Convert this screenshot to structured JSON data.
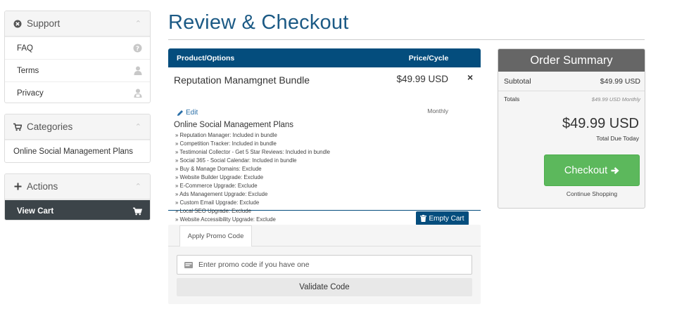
{
  "sidebar": {
    "support": {
      "title": "Support",
      "items": [
        {
          "label": "FAQ"
        },
        {
          "label": "Terms"
        },
        {
          "label": "Privacy"
        }
      ]
    },
    "categories": {
      "title": "Categories",
      "items": [
        {
          "label": "Online Social Management Plans"
        }
      ]
    },
    "actions": {
      "title": "Actions",
      "items": [
        {
          "label": "View Cart"
        }
      ]
    }
  },
  "page": {
    "title": "Review & Checkout"
  },
  "cart": {
    "headers": {
      "product": "Product/Options",
      "price": "Price/Cycle"
    },
    "item": {
      "name": "Reputation Manamgnet Bundle",
      "edit_label": "Edit",
      "price": "$49.99 USD",
      "cycle": "Monthly",
      "remove_symbol": "×",
      "group": "Online Social Management Plans",
      "options": [
        "» Reputation Manager: Included in bundle",
        "» Competition Tracker: Included in bundle",
        "» Testimonial Collector - Get 5 Star Reviews: Included in bundle",
        "» Social 365 - Social Calendar: Included in bundle",
        "» Buy & Manage Domains: Exclude",
        "» Website Builder Upgrade: Exclude",
        "» E-Commerce Upgrade: Exclude",
        "» Ads Management Upgrade: Exclude",
        "» Custom Email Upgrade: Exclude",
        "» Local SEO Upgrade: Exclude",
        "» Website Accessibility Upgrade: Exclude"
      ]
    },
    "empty_cart_label": "Empty Cart"
  },
  "promo": {
    "tab_label": "Apply Promo Code",
    "placeholder": "Enter promo code if you have one",
    "validate_label": "Validate Code"
  },
  "summary": {
    "title": "Order Summary",
    "subtotal_label": "Subtotal",
    "subtotal_value": "$49.99 USD",
    "totals_label": "Totals",
    "totals_value": "$49.99 USD Monthly",
    "total_amount": "$49.99 USD",
    "total_due_label": "Total Due Today",
    "checkout_label": "Checkout",
    "continue_label": "Continue Shopping"
  },
  "colors": {
    "brand_blue": "#044d7d",
    "title_blue": "#1c5a85",
    "checkout_green": "#5cb85c",
    "sidebar_active": "#3c4449",
    "summary_header": "#666666"
  },
  "icons": {
    "support": "circle-x-icon",
    "faq": "question-circle-icon",
    "terms": "user-icon",
    "privacy": "lock-user-icon",
    "categories": "cart-icon",
    "actions": "plus-icon",
    "view_cart": "cart-icon",
    "edit": "pencil-icon",
    "empty_cart": "trash-icon",
    "promo": "ticket-icon",
    "checkout": "arrow-right-icon"
  }
}
